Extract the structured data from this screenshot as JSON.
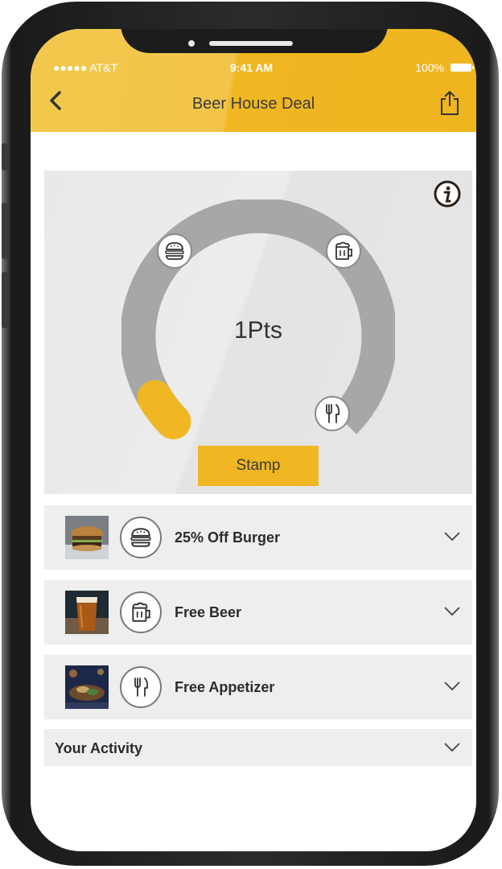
{
  "status_bar": {
    "carrier": "●●●●● AT&T",
    "time": "9:41 AM",
    "battery": "100%"
  },
  "header": {
    "title": "Beer House Deal",
    "back_icon": "chevron-left-icon",
    "share_icon": "share-icon"
  },
  "colors": {
    "accent": "#f0b722",
    "header_light": "#f2c94c",
    "card_bg": "#e9e9e9",
    "item_bg": "#eeeeee",
    "gauge_track": "#a7a7a7"
  },
  "rewards_card": {
    "points_label": "1Pts",
    "points_value": 1,
    "stamp_label": "Stamp",
    "info_icon": "info-icon",
    "milestone_icons": [
      "burger-icon",
      "beer-mug-icon",
      "fork-knife-icon"
    ]
  },
  "rewards": [
    {
      "label": "25% Off Burger",
      "icon": "burger-icon",
      "thumb": "burger-photo"
    },
    {
      "label": "Free Beer",
      "icon": "beer-mug-icon",
      "thumb": "beer-photo"
    },
    {
      "label": "Free Appetizer",
      "icon": "fork-knife-icon",
      "thumb": "appetizer-photo"
    }
  ],
  "activity": {
    "label": "Your Activity"
  }
}
